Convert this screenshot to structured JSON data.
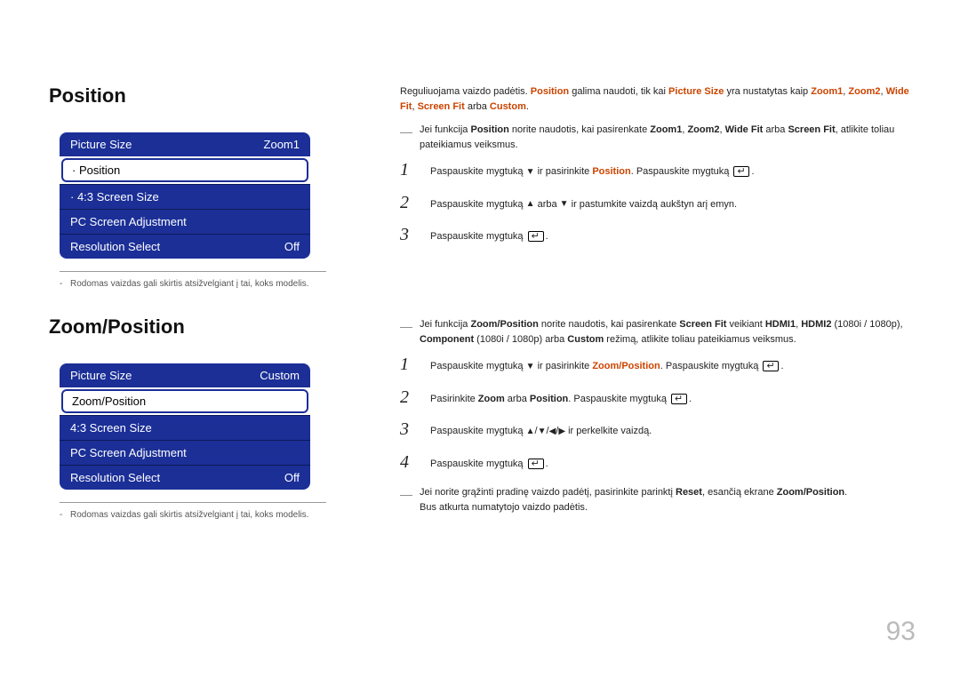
{
  "pageNumber": "93",
  "position": {
    "title": "Position",
    "menu": {
      "pictureSizeLabel": "Picture Size",
      "pictureSizeValue": "Zoom1",
      "selected": "· Position",
      "screenSize": "· 4:3 Screen Size",
      "pcAdjust": "PC Screen Adjustment",
      "resolutionSelectLabel": "Resolution Select",
      "resolutionSelectValue": "Off"
    },
    "note": "Rodomas vaizdas gali skirtis atsižvelgiant į tai, koks modelis.",
    "intro": {
      "pre": "Reguliuojama vaizdo padėtis. ",
      "posWord": "Position",
      "mid1": " galima naudoti, tik kai ",
      "psWord": "Picture Size",
      "mid2": " yra nustatytas kaip ",
      "zl": "Zoom1",
      "c1": ", ",
      "z2": "Zoom2",
      "c2": ", ",
      "wf": "Wide Fit",
      "c3": ", ",
      "sf": "Screen Fit",
      "or": " arba ",
      "cu": "Custom",
      "end": "."
    },
    "tip": {
      "pre": "Jei funkcija ",
      "posWord": "Position",
      "mid1": " norite naudotis, kai pasirenkate ",
      "z1": "Zoom1",
      "c1": ", ",
      "z2": "Zoom2",
      "c2": ", ",
      "wf": "Wide Fit",
      "or": " arba ",
      "sf": "Screen Fit",
      "end": ", atlikite toliau pateikiamus veiksmus."
    },
    "steps": {
      "1": {
        "a": "Paspauskite mygtuką ",
        "b": " ir pasirinkite ",
        "pos": "Position",
        "c": ". Paspauskite mygtuką "
      },
      "2": {
        "a": "Paspauskite mygtuką ",
        "b": " arba ",
        "c": " ir pastumkite vaizdą aukštyn arį emyn."
      },
      "3": {
        "a": "Paspauskite mygtuką "
      }
    }
  },
  "zoomPosition": {
    "title": "Zoom/Position",
    "menu": {
      "pictureSizeLabel": "Picture Size",
      "pictureSizeValue": "Custom",
      "selected": "Zoom/Position",
      "screenSize": "4:3 Screen Size",
      "pcAdjust": "PC Screen Adjustment",
      "resolutionSelectLabel": "Resolution Select",
      "resolutionSelectValue": "Off"
    },
    "note": "Rodomas vaizdas gali skirtis atsižvelgiant į tai, koks modelis.",
    "tip1": {
      "pre": "Jei funkcija ",
      "zp": "Zoom/Position",
      "mid1": " norite naudotis, kai pasirenkate ",
      "sf": "Screen Fit",
      "via": " veikiant ",
      "h1": "HDMI1",
      "c1": ", ",
      "h2": "HDMI2",
      "res1": " (1080i / 1080p), ",
      "comp": "Component",
      "res2": " (1080i / 1080p) arba ",
      "cu": "Custom",
      "end": " režimą, atlikite toliau pateikiamus veiksmus."
    },
    "steps": {
      "1": {
        "a": "Paspauskite mygtuką ",
        "b": " ir pasirinkite ",
        "zp": "Zoom/Position",
        "c": ". Paspauskite mygtuką "
      },
      "2": {
        "a": "Pasirinkite ",
        "z": "Zoom",
        "b": " arba ",
        "p": "Position",
        "c": ". Paspauskite mygtuką "
      },
      "3": {
        "a": "Paspauskite mygtuką ",
        "b": " ir perkelkite vaizdą."
      },
      "4": {
        "a": "Paspauskite mygtuką "
      }
    },
    "tip2": {
      "pre": "Jei norite grąžinti pradinę vaizdo padėtį, pasirinkite parinktį ",
      "reset": "Reset",
      "mid": ", esančią ekrane ",
      "zp": "Zoom/Position",
      "end1": ".",
      "line2": "Bus atkurta numatytojo vaizdo padėtis."
    }
  }
}
